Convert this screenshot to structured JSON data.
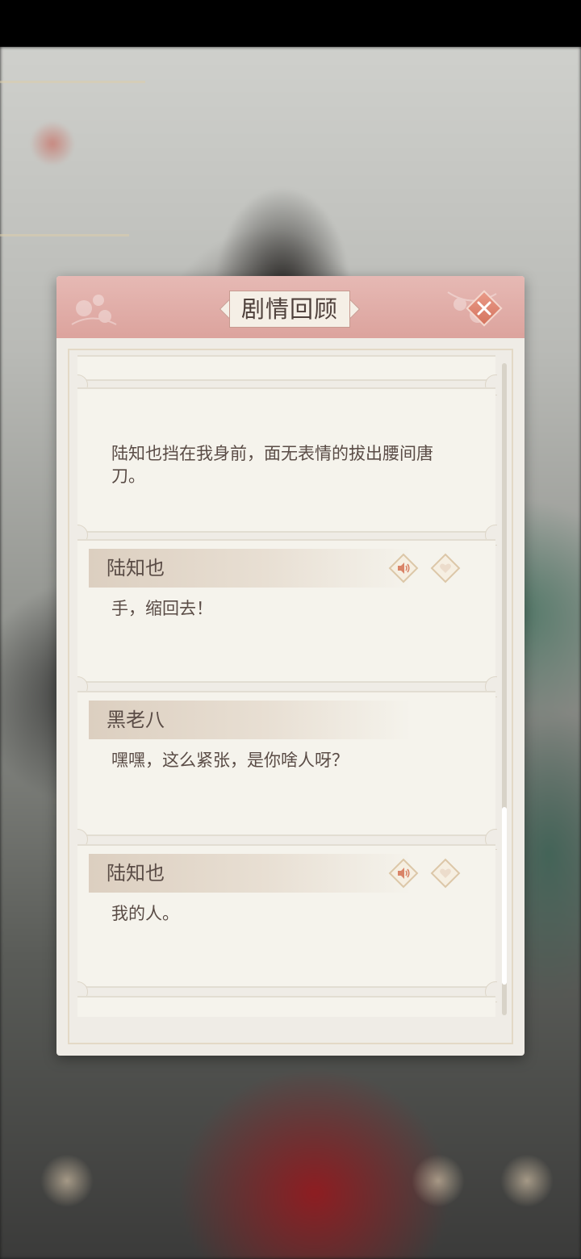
{
  "dialog": {
    "title": "剧情回顾",
    "close_icon": "close-icon"
  },
  "entries": [
    {
      "speaker": "",
      "text": "陆知也挡在我身前，面无表情的拔出腰间唐刀。",
      "has_voice": false
    },
    {
      "speaker": "陆知也",
      "text": "手，缩回去！",
      "has_voice": true
    },
    {
      "speaker": "黑老八",
      "text": "嘿嘿，这么紧张，是你啥人呀？",
      "has_voice": false
    },
    {
      "speaker": "陆知也",
      "text": "我的人。",
      "has_voice": true
    }
  ],
  "icons": {
    "voice": "speaker-icon",
    "like": "heart-icon"
  },
  "colors": {
    "header": "#dca39d",
    "panel": "#efece6",
    "card": "#f5f3ec",
    "text": "#5a4c46",
    "accent": "#d5755f"
  }
}
